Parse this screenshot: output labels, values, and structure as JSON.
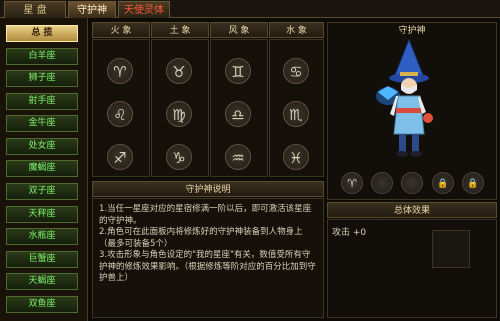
{
  "tabs": [
    {
      "label": "星 盘"
    },
    {
      "label": "守护神"
    },
    {
      "label": "天使灵体"
    }
  ],
  "sidebar": {
    "items": [
      {
        "label": "总 揽"
      },
      {
        "label": "白羊座"
      },
      {
        "label": "狮子座"
      },
      {
        "label": "射手座"
      },
      {
        "label": "金牛座"
      },
      {
        "label": "处女座"
      },
      {
        "label": "魔蝎座"
      },
      {
        "label": "双子座"
      },
      {
        "label": "天秤座"
      },
      {
        "label": "水瓶座"
      },
      {
        "label": "巨蟹座"
      },
      {
        "label": "天蝎座"
      },
      {
        "label": "双鱼座"
      }
    ]
  },
  "elements": [
    {
      "name": "火 象",
      "signs": [
        "♈",
        "♌",
        "♐"
      ]
    },
    {
      "name": "土 象",
      "signs": [
        "♉",
        "♍",
        "♑"
      ]
    },
    {
      "name": "风 象",
      "signs": [
        "♊",
        "♎",
        "♒"
      ]
    },
    {
      "name": "水 象",
      "signs": [
        "♋",
        "♏",
        "♓"
      ]
    }
  ],
  "guardian": {
    "title": "守护神",
    "slots": [
      {
        "glyph": "♈",
        "icon": "aries-icon"
      },
      {
        "glyph": "",
        "icon": "empty-slot"
      },
      {
        "glyph": "",
        "icon": "empty-slot"
      },
      {
        "glyph": "🔒",
        "icon": "lock-icon"
      },
      {
        "glyph": "🔒",
        "icon": "lock-icon"
      }
    ]
  },
  "explanation": {
    "title": "守护神说明",
    "lines": [
      "1.当任一星座对应的星宿修满一阶以后，即可激活该星座的守护神。",
      "2.角色可在此面板内将修炼好的守护神装备到人物身上（最多可装备5个）",
      "3.攻击形象与角色设定的\"我的星座\"有关，数值受所有守护神的修炼效果影响。（根据修炼等阶对应的百分比加到守护兽上）"
    ]
  },
  "total_effect": {
    "title": "总体效果",
    "stat": "攻击 +0"
  },
  "colors": {
    "accent": "#e8d08a",
    "sidebar_text": "#7df06a",
    "red_tab": "#ff5a3a"
  }
}
